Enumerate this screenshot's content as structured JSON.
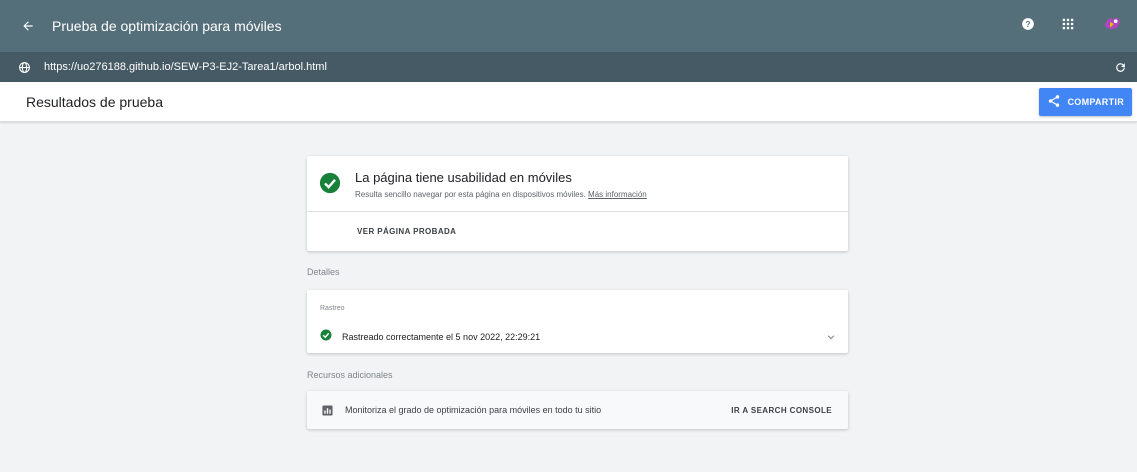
{
  "topbar": {
    "title": "Prueba de optimización para móviles",
    "help_icon": "help-circle-icon",
    "apps_icon": "apps-grid-icon"
  },
  "urlbar": {
    "url": "https://uo276188.github.io/SEW-P3-EJ2-Tarea1/arbol.html"
  },
  "header": {
    "title": "Resultados de prueba",
    "share_label": "COMPARTIR"
  },
  "result": {
    "title": "La página tiene usabilidad en móviles",
    "subtitle": "Resulta sencillo navegar por esta página en dispositivos móviles.",
    "more_info": "Más información",
    "view_page": "VER PÁGINA PROBADA"
  },
  "details": {
    "label": "Detalles",
    "crawl_label": "Rastreo",
    "crawl_status": "Rastreado correctamente el 5 nov 2022, 22:29:21"
  },
  "resources": {
    "label": "Recursos adicionales",
    "text": "Monitoriza el grado de optimización para móviles en todo tu sitio",
    "link": "IR A SEARCH CONSOLE"
  },
  "colors": {
    "topbar": "#546e7a",
    "urlbar": "#455a64",
    "accent": "#4285f4",
    "success": "#188038"
  }
}
